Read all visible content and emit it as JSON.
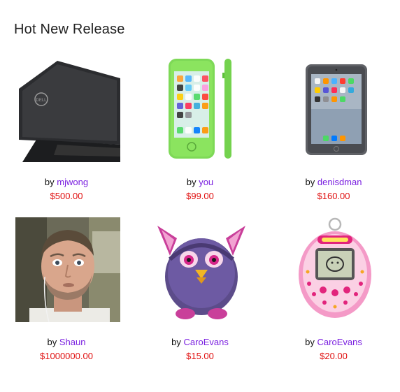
{
  "section": {
    "title": "Hot New Release"
  },
  "products": [
    {
      "image_icon": "laptop-image",
      "by_label": "by",
      "seller": "mjwong",
      "price": "$500.00"
    },
    {
      "image_icon": "phone-image",
      "by_label": "by",
      "seller": "you",
      "price": "$99.00"
    },
    {
      "image_icon": "tablet-image",
      "by_label": "by",
      "seller": "denisdman",
      "price": "$160.00"
    },
    {
      "image_icon": "person-photo",
      "by_label": "by",
      "seller": "Shaun",
      "price": "$1000000.00"
    },
    {
      "image_icon": "furby-toy-image",
      "by_label": "by",
      "seller": "CaroEvans",
      "price": "$15.00"
    },
    {
      "image_icon": "tamagotchi-image",
      "by_label": "by",
      "seller": "CaroEvans",
      "price": "$20.00"
    }
  ],
  "colors": {
    "seller_link": "#7a1fe0",
    "price": "#e01010"
  }
}
